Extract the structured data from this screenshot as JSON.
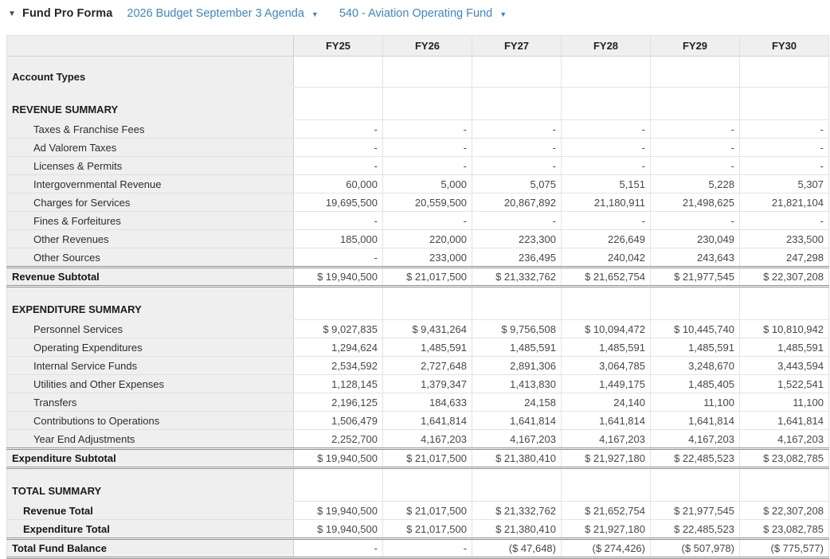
{
  "toolbar": {
    "collapse_icon": "▼",
    "title": "Fund Pro Forma",
    "budget_dropdown": {
      "label": "2026 Budget September 3 Agenda",
      "arrow": "▼"
    },
    "fund_dropdown": {
      "label": "540 - Aviation Operating Fund",
      "arrow": "▼"
    }
  },
  "table": {
    "columns": [
      "FY25",
      "FY26",
      "FY27",
      "FY28",
      "FY29",
      "FY30"
    ],
    "rows": [
      {
        "style": "account",
        "label": "Account Types",
        "values": [
          "",
          "",
          "",
          "",
          "",
          ""
        ]
      },
      {
        "style": "section",
        "label": "REVENUE SUMMARY",
        "values": [
          "",
          "",
          "",
          "",
          "",
          ""
        ]
      },
      {
        "style": "item",
        "label": "Taxes & Franchise Fees",
        "values": [
          "-",
          "-",
          "-",
          "-",
          "-",
          "-"
        ]
      },
      {
        "style": "item",
        "label": "Ad Valorem Taxes",
        "values": [
          "-",
          "-",
          "-",
          "-",
          "-",
          "-"
        ]
      },
      {
        "style": "item",
        "label": "Licenses & Permits",
        "values": [
          "-",
          "-",
          "-",
          "-",
          "-",
          "-"
        ]
      },
      {
        "style": "item",
        "label": "Intergovernmental Revenue",
        "values": [
          "60,000",
          "5,000",
          "5,075",
          "5,151",
          "5,228",
          "5,307"
        ]
      },
      {
        "style": "item",
        "label": "Charges for Services",
        "values": [
          "19,695,500",
          "20,559,500",
          "20,867,892",
          "21,180,911",
          "21,498,625",
          "21,821,104"
        ]
      },
      {
        "style": "item",
        "label": "Fines & Forfeitures",
        "values": [
          "-",
          "-",
          "-",
          "-",
          "-",
          "-"
        ]
      },
      {
        "style": "item",
        "label": "Other Revenues",
        "values": [
          "185,000",
          "220,000",
          "223,300",
          "226,649",
          "230,049",
          "233,500"
        ]
      },
      {
        "style": "item",
        "label": "Other Sources",
        "values": [
          "-",
          "233,000",
          "236,495",
          "240,042",
          "243,643",
          "247,298"
        ]
      },
      {
        "style": "subtotal",
        "label": "Revenue Subtotal",
        "values": [
          "$ 19,940,500",
          "$ 21,017,500",
          "$ 21,332,762",
          "$ 21,652,754",
          "$ 21,977,545",
          "$ 22,307,208"
        ]
      },
      {
        "style": "section",
        "label": "EXPENDITURE SUMMARY",
        "values": [
          "",
          "",
          "",
          "",
          "",
          ""
        ]
      },
      {
        "style": "item",
        "label": "Personnel Services",
        "values": [
          "$ 9,027,835",
          "$ 9,431,264",
          "$ 9,756,508",
          "$ 10,094,472",
          "$ 10,445,740",
          "$ 10,810,942"
        ]
      },
      {
        "style": "item",
        "label": "Operating Expenditures",
        "values": [
          "1,294,624",
          "1,485,591",
          "1,485,591",
          "1,485,591",
          "1,485,591",
          "1,485,591"
        ]
      },
      {
        "style": "item",
        "label": "Internal Service Funds",
        "values": [
          "2,534,592",
          "2,727,648",
          "2,891,306",
          "3,064,785",
          "3,248,670",
          "3,443,594"
        ]
      },
      {
        "style": "item",
        "label": "Utilities and Other Expenses",
        "values": [
          "1,128,145",
          "1,379,347",
          "1,413,830",
          "1,449,175",
          "1,485,405",
          "1,522,541"
        ]
      },
      {
        "style": "item",
        "label": "Transfers",
        "values": [
          "2,196,125",
          "184,633",
          "24,158",
          "24,140",
          "11,100",
          "11,100"
        ]
      },
      {
        "style": "item",
        "label": "Contributions to Operations",
        "values": [
          "1,506,479",
          "1,641,814",
          "1,641,814",
          "1,641,814",
          "1,641,814",
          "1,641,814"
        ]
      },
      {
        "style": "item",
        "label": "Year End Adjustments",
        "values": [
          "2,252,700",
          "4,167,203",
          "4,167,203",
          "4,167,203",
          "4,167,203",
          "4,167,203"
        ]
      },
      {
        "style": "subtotal",
        "label": "Expenditure Subtotal",
        "values": [
          "$ 19,940,500",
          "$ 21,017,500",
          "$ 21,380,410",
          "$ 21,927,180",
          "$ 22,485,523",
          "$ 23,082,785"
        ]
      },
      {
        "style": "section",
        "label": "TOTAL SUMMARY",
        "values": [
          "",
          "",
          "",
          "",
          "",
          ""
        ]
      },
      {
        "style": "total-item",
        "label": "Revenue Total",
        "values": [
          "$ 19,940,500",
          "$ 21,017,500",
          "$ 21,332,762",
          "$ 21,652,754",
          "$ 21,977,545",
          "$ 22,307,208"
        ]
      },
      {
        "style": "total-item",
        "label": "Expenditure Total",
        "values": [
          "$ 19,940,500",
          "$ 21,017,500",
          "$ 21,380,410",
          "$ 21,927,180",
          "$ 22,485,523",
          "$ 23,082,785"
        ]
      },
      {
        "style": "grand",
        "label": "Total Fund Balance",
        "values": [
          "-",
          "-",
          "($ 47,648)",
          "($ 274,426)",
          "($ 507,978)",
          "($ 775,577)"
        ]
      }
    ]
  },
  "colors": {
    "link_blue": "#3e86c7",
    "label_bg": "#efefef",
    "grid_line": "#e3e3e3",
    "double_rule": "#8f8f8f"
  }
}
